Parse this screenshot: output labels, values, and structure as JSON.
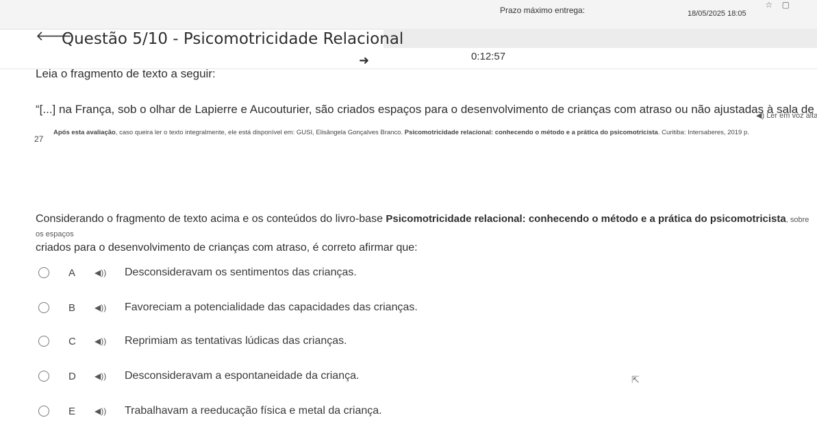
{
  "topbar": {
    "due_label": "Prazo máximo entrega:",
    "due_value": "18/05/2025 18:05"
  },
  "header": {
    "title": "Questão 5/10 - Psicomotricidade Relacional",
    "timer": "0:12:57"
  },
  "icons": {
    "back": "arrow-left-icon",
    "forward": "arrow-right-icon",
    "speaker": "speaker-icon",
    "star": "star-icon",
    "window": "window-icon",
    "cursor": "mouse-pointer-icon"
  },
  "content": {
    "instruction": "Leia o fragmento de texto a seguir:",
    "read_aloud": "Ler em voz alta",
    "quote": "“[...] na França, sob o olhar de Lapierre e Aucouturier, são criados espaços para o desenvolvimento de crianças com atraso ou não ajustadas à sala de aula”.",
    "quote_number": "27",
    "reference_lead": "Após esta avaliação",
    "reference_text": ", caso queira ler o texto integralmente, ele está disponível em: GUSI, Elisângela Gonçalves Branco. ",
    "reference_book": "Psicomotricidade relacional: conhecendo o método e a prática do psicomotricista",
    "reference_end": ". Curitiba: Intersaberes, 2019 p.",
    "question_start": "Considerando o fragmento de texto acima e os conteúdos do livro-base ",
    "question_book": "Psicomotricidade relacional: conhecendo o método e a prática do psicomotricista",
    "question_tail": ", sobre os espaços",
    "question_end": "criados para o desenvolvimento de crianças com atraso, é correto afirmar que:"
  },
  "options": [
    {
      "letter": "A",
      "text": "Desconsideravam os sentimentos das crianças."
    },
    {
      "letter": "B",
      "text": "Favoreciam a potencialidade das capacidades das crianças."
    },
    {
      "letter": "C",
      "text": "Reprimiam as tentativas lúdicas das crianças."
    },
    {
      "letter": "D",
      "text": "Desconsideravam a espontaneidade da criança."
    },
    {
      "letter": "E",
      "text": "Trabalhavam a reeducação física e metal da criança."
    }
  ]
}
